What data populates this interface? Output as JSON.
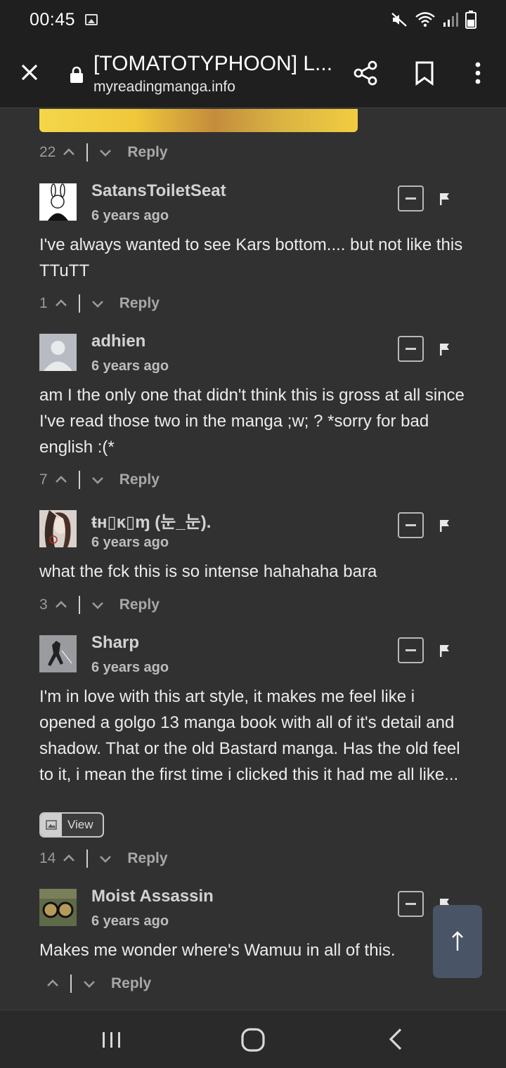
{
  "status_bar": {
    "time": "00:45"
  },
  "browser": {
    "title": "[TOMATOTYPHOON] L...",
    "url": "myreadingmanga.info"
  },
  "top_votes": {
    "count": "22",
    "reply_label": "Reply"
  },
  "comments": [
    {
      "username": "SatansToiletSeat",
      "time": "6 years ago",
      "text": "I've always wanted to see Kars bottom.... but not like this TTuTT",
      "votes": "1",
      "reply_label": "Reply"
    },
    {
      "username": "adhien",
      "time": "6 years ago",
      "text": "am I the only one that didn't think this is gross at all since I've read those two in the manga ;w; ? *sorry for bad english :(*",
      "votes": "7",
      "reply_label": "Reply"
    },
    {
      "username": "ŧʜ▯ĸ▯ɱ (눈_눈).",
      "time": "6 years ago",
      "text": "what the fck this is so intense hahahaha bara",
      "votes": "3",
      "reply_label": "Reply"
    },
    {
      "username": "Sharp",
      "time": "6 years ago",
      "text": "I'm in love with this art style, it makes me feel like i opened a golgo 13 manga book with all of it's detail and shadow. That or the old Bastard manga. Has the old feel to it, i mean the first time i clicked this it had me all like...",
      "view_label": "View",
      "votes": "14",
      "reply_label": "Reply"
    },
    {
      "username": "Moist Assassin",
      "time": "6 years ago",
      "text": "Makes me wonder where's Wamuu in all of this.",
      "votes": "",
      "reply_label": "Reply"
    }
  ],
  "colors": {
    "background": "#313131",
    "bar": "#1f1f1f",
    "scroll_button": "#4a5467"
  }
}
